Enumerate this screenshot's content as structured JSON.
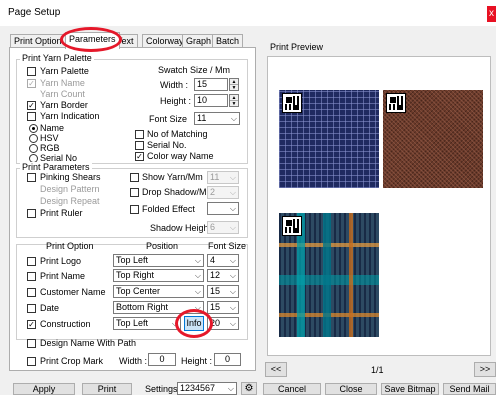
{
  "window": {
    "title": "Page Setup",
    "close_glyph": "x"
  },
  "tabs": [
    "Print Option",
    "Parameters",
    "Text",
    "Colorway",
    "Graph",
    "Batch"
  ],
  "yarn_palette": {
    "legend": "Print Yarn Palette",
    "yarn_palette": "Yarn Palette",
    "yarn_name": "Yarn Name",
    "yarn_count": "Yarn Count",
    "yarn_border": "Yarn Border",
    "yarn_indication": "Yarn Indication",
    "radios": [
      "Name",
      "HSV",
      "RGB",
      "Serial No"
    ],
    "swatch_size_label": "Swatch Size / Mm",
    "width_label": "Width :",
    "width_value": "15",
    "height_label": "Height :",
    "height_value": "10",
    "font_size_label": "Font Size",
    "font_size_value": "11",
    "no_of_matching": "No of Matching",
    "serial_no": "Serial No.",
    "color_way_name": "Color way Name"
  },
  "print_parameters": {
    "legend": "Print Parameters",
    "pinking_shears": "Pinking Shears",
    "design_pattern": "Design Pattern",
    "design_repeat": "Design Repeat",
    "print_ruler": "Print Ruler",
    "show_yarn": "Show Yarn/Mm",
    "show_yarn_value": "11",
    "drop_shadow": "Drop Shadow/Mm",
    "drop_shadow_value": "2",
    "folded_effect": "Folded Effect",
    "shadow_height_label": "Shadow Height :",
    "shadow_height_value": "6"
  },
  "print_option": {
    "headers": {
      "option": "Print Option",
      "position": "Position",
      "font_size": "Font Size"
    },
    "rows": [
      {
        "label": "Print Logo",
        "position": "Top Left",
        "size": "4"
      },
      {
        "label": "Print Name",
        "position": "Top Right",
        "size": "12"
      },
      {
        "label": "Customer Name",
        "position": "Top Center",
        "size": "15"
      },
      {
        "label": "Date",
        "position": "Bottom Right",
        "size": "15"
      },
      {
        "label": "Construction",
        "position": "Top Left",
        "size": "20"
      }
    ],
    "info_button": "Info",
    "design_name_with_path": "Design Name With Path",
    "print_crop_mark": "Print Crop Mark",
    "crop_width_label": "Width :",
    "crop_width_value": "0",
    "crop_height_label": "Height :",
    "crop_height_value": "0"
  },
  "preview": {
    "label": "Print Preview",
    "prev": "<<",
    "next": ">>",
    "page": "1/1"
  },
  "footer": {
    "apply": "Apply",
    "print": "Print",
    "settings_label": "Settings",
    "settings_value": "1234567",
    "cancel": "Cancel",
    "close": "Close",
    "save_bitmap": "Save Bitmap",
    "send_mail": "Send Mail"
  },
  "colors": {
    "swatch1_base": "#1f2a60",
    "swatch2_base": "#6b3a2a",
    "swatch3_base": "#2d4a63",
    "highlight_ring": "#e5182a"
  },
  "icons": [
    "check-icon",
    "dropdown-arrow-icon",
    "spin-up-icon",
    "spin-down-icon",
    "qr-code-icon",
    "settings-icon"
  ]
}
